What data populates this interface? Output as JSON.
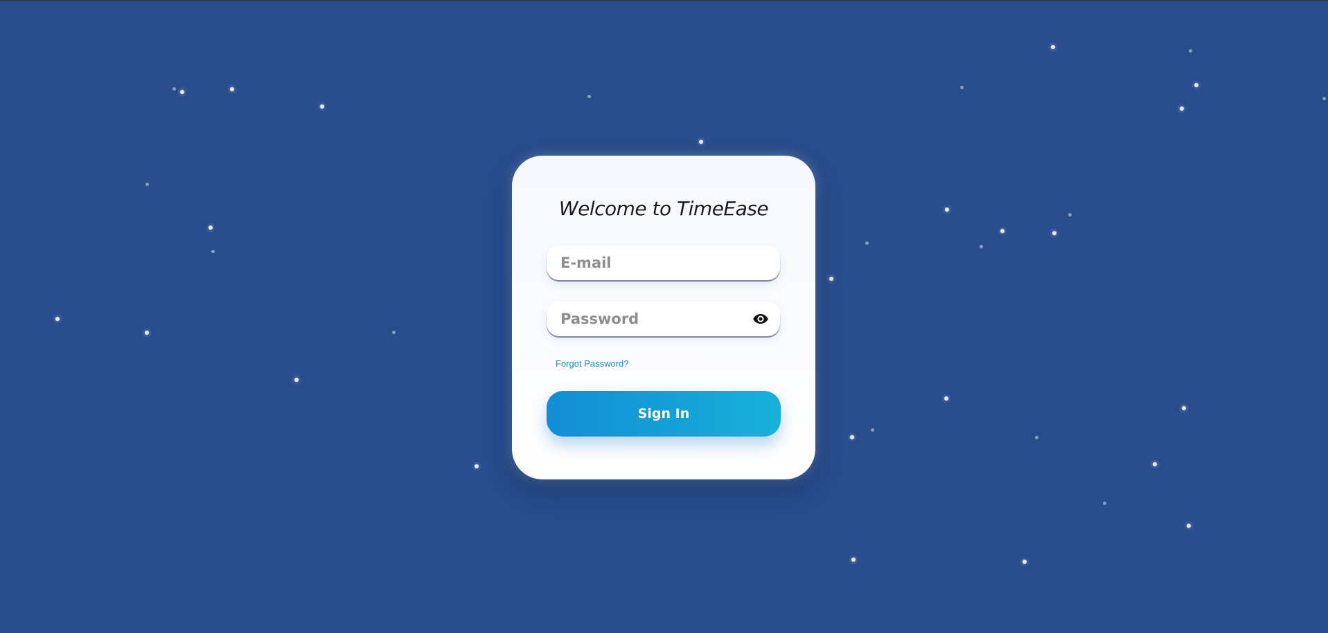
{
  "login": {
    "title": "Welcome to TimeEase",
    "email_placeholder": "E-mail",
    "password_placeholder": "Password",
    "forgot_password": "Forgot Password?",
    "sign_in": "Sign In"
  },
  "icons": {
    "password_toggle": "eye-icon"
  },
  "colors": {
    "background": "#284c8c",
    "card": "#ffffff",
    "button_start": "#138dd6",
    "button_end": "#16b1d8",
    "link": "#1a8ad6"
  }
}
